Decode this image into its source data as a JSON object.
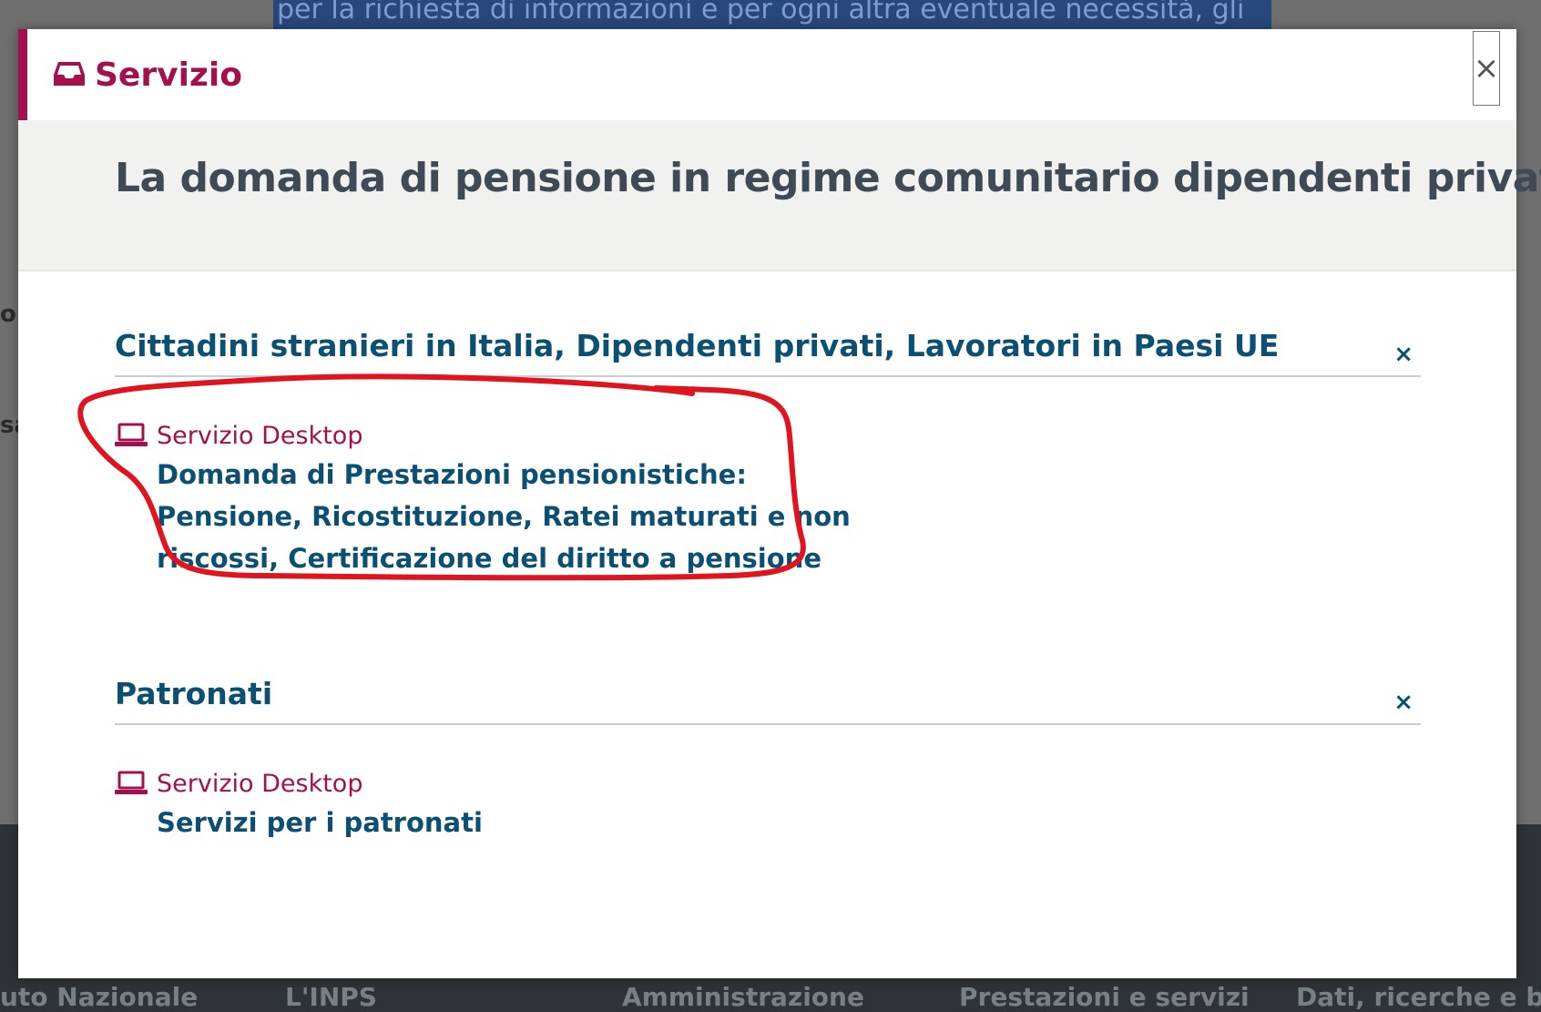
{
  "background": {
    "selected_text": "per la richiesta di informazioni e per ogni altra eventuale necessità, gli",
    "edge_fragments": [
      "or",
      "sa"
    ],
    "footer_links": [
      "uto Nazionale",
      "L'INPS",
      "Amministrazione",
      "Prestazioni e servizi",
      "Dati, ricerche e bila"
    ]
  },
  "modal": {
    "header_icon": "inbox-icon",
    "header_title": "Servizio",
    "close_label": "×",
    "page_title": "La domanda di pensione in regime comunitario dipendenti privati",
    "sections": [
      {
        "title": "Cittadini stranieri in Italia, Dipendenti privati, Lavoratori in Paesi UE",
        "toggle": "×",
        "service_kind": "Servizio Desktop",
        "service_icon": "laptop-icon",
        "service_link": "Domanda di Prestazioni pensionistiche: Pensione, Ricostituzione, Ratei maturati e non riscossi, Certificazione del diritto a pensione",
        "service_link_lines": [
          "Domanda di Prestazioni pensionistiche:",
          "Pensione, Ricostituzione, Ratei maturati e non",
          "riscossi, Certificazione del diritto a pensione"
        ]
      },
      {
        "title": "Patronati",
        "toggle": "×",
        "service_kind": "Servizio Desktop",
        "service_icon": "laptop-icon",
        "service_link": "Servizi per i patronati"
      }
    ]
  },
  "colors": {
    "accent": "#a3114d",
    "link": "#0b5072",
    "title": "#3f4a57",
    "annotation": "#e0141e"
  }
}
